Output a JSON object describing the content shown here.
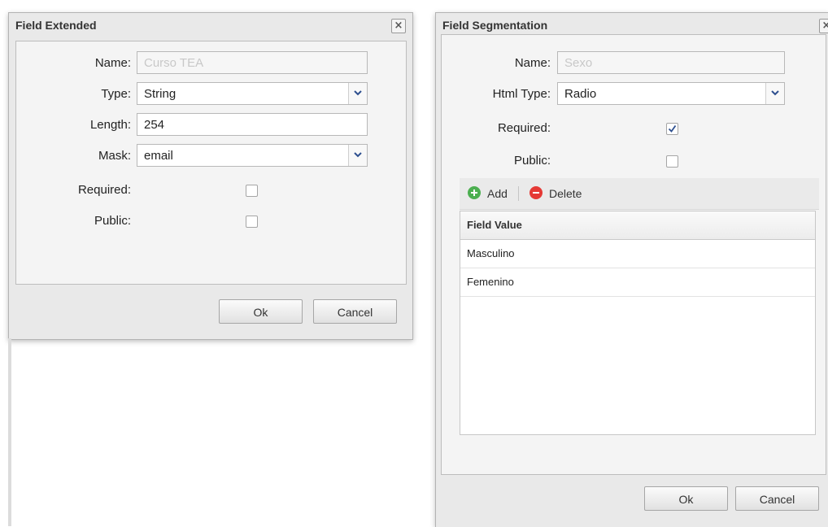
{
  "dialog_left": {
    "title": "Field Extended",
    "close_glyph": "×",
    "fields": {
      "name_label": "Name:",
      "name_value": "Curso TEA",
      "type_label": "Type:",
      "type_value": "String",
      "length_label": "Length:",
      "length_value": "254",
      "mask_label": "Mask:",
      "mask_value": "email",
      "required_label": "Required:",
      "required_checked": false,
      "public_label": "Public:",
      "public_checked": false
    },
    "buttons": {
      "ok": "Ok",
      "cancel": "Cancel"
    }
  },
  "dialog_right": {
    "title": "Field Segmentation",
    "close_glyph": "×",
    "fields": {
      "name_label": "Name:",
      "name_value": "Sexo",
      "html_type_label": "Html Type:",
      "html_type_value": "Radio",
      "required_label": "Required:",
      "required_checked": true,
      "public_label": "Public:",
      "public_checked": false
    },
    "toolbar": {
      "add": "Add",
      "delete": "Delete"
    },
    "grid": {
      "header": "Field Value",
      "rows": [
        "Masculino",
        "Femenino"
      ]
    },
    "buttons": {
      "ok": "Ok",
      "cancel": "Cancel"
    }
  },
  "colors": {
    "add_icon": "#4caf50",
    "delete_icon": "#e53935",
    "combo_arrow": "#2d4f8f"
  }
}
